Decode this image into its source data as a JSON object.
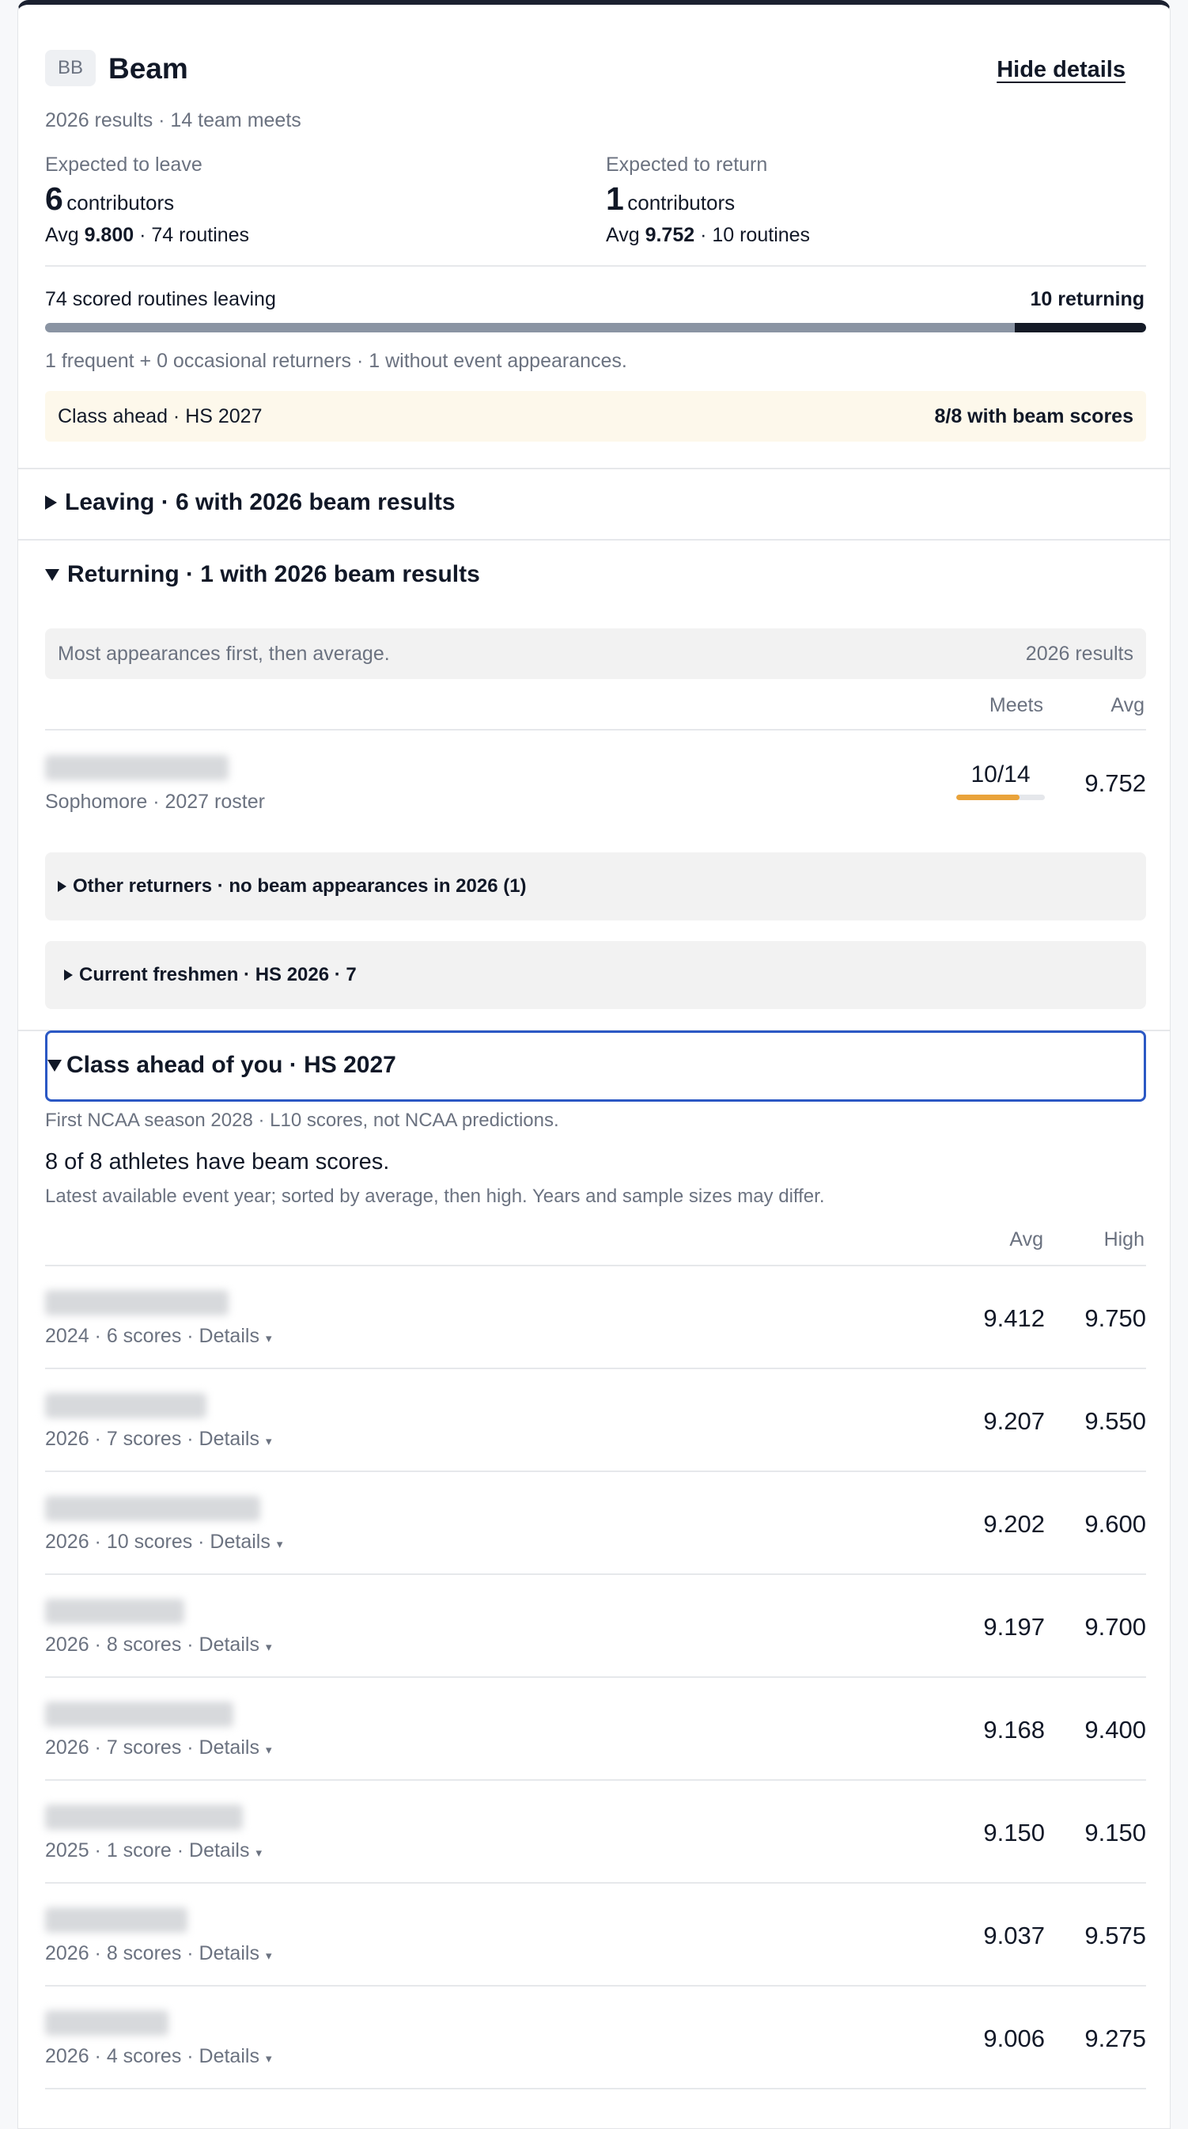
{
  "header": {
    "badge": "BB",
    "title": "Beam",
    "hide_details": "Hide details",
    "subtitle": "2026 results · 14 team meets"
  },
  "summary": {
    "leave": {
      "label": "Expected to leave",
      "count": "6",
      "count_suffix": "contributors",
      "avg_prefix": "Avg ",
      "avg": "9.800",
      "routines": " · 74 routines"
    },
    "return": {
      "label": "Expected to return",
      "count": "1",
      "count_suffix": "contributors",
      "avg_prefix": "Avg ",
      "avg": "9.752",
      "routines": " · 10 routines"
    }
  },
  "routines_bar": {
    "left_label": "74 scored routines leaving",
    "right_label": "10 returning",
    "returning_fraction": 0.119,
    "note": "1 frequent + 0 occasional returners · 1 without event appearances."
  },
  "callout": {
    "left": "Class ahead · HS 2027",
    "right": "8/8 with beam scores"
  },
  "leaving_section": {
    "title": "Leaving · 6 with 2026 beam results"
  },
  "returning_section": {
    "title": "Returning · 1 with 2026 beam results",
    "note": "Most appearances first, then average.",
    "results_label": "2026 results",
    "col_meets": "Meets",
    "col_avg": "Avg",
    "athlete": {
      "meta": "Sophomore · 2027 roster",
      "meets": "10/14",
      "meets_fraction": 0.714,
      "avg": "9.752"
    },
    "other_returners": "Other returners · no beam appearances in 2026 (1)",
    "freshmen": "Current freshmen · HS 2026 · 7"
  },
  "class_ahead": {
    "title": "Class ahead of you · HS 2027",
    "note": "First NCAA season 2028 · L10 scores, not NCAA predictions.",
    "headline": "8 of 8 athletes have beam scores.",
    "subnote": "Latest available event year; sorted by average, then high. Years and sample sizes may differ.",
    "col_avg": "Avg",
    "col_high": "High",
    "rows": [
      {
        "meta": "2024 · 6 scores · Details",
        "avg": "9.412",
        "high": "9.750"
      },
      {
        "meta": "2026 · 7 scores · Details",
        "avg": "9.207",
        "high": "9.550"
      },
      {
        "meta": "2026 · 10 scores · Details",
        "avg": "9.202",
        "high": "9.600"
      },
      {
        "meta": "2026 · 8 scores · Details",
        "avg": "9.197",
        "high": "9.700"
      },
      {
        "meta": "2026 · 7 scores · Details",
        "avg": "9.168",
        "high": "9.400"
      },
      {
        "meta": "2025 · 1 score · Details",
        "avg": "9.150",
        "high": "9.150"
      },
      {
        "meta": "2026 · 8 scores · Details",
        "avg": "9.037",
        "high": "9.575"
      },
      {
        "meta": "2026 · 4 scores · Details",
        "avg": "9.006",
        "high": "9.275"
      }
    ]
  },
  "icons": {
    "collapsed": "triangle-right-icon",
    "expanded": "triangle-down-icon",
    "details_caret": "▾"
  },
  "colors": {
    "dark": "#141a26",
    "bar_leaving": "#8a94a3",
    "callout_bg": "#fdf8eb",
    "progress": "#e9a33a",
    "focus": "#2b58c4"
  }
}
